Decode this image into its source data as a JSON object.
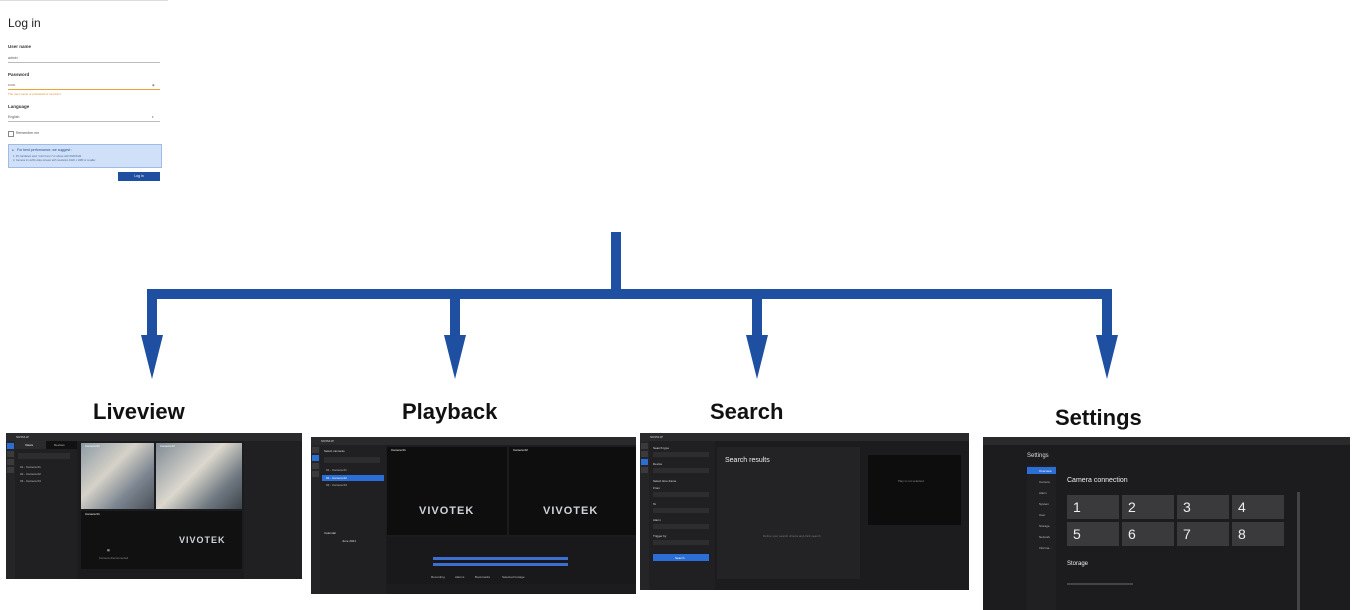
{
  "login": {
    "title": "Log in",
    "username_label": "User name",
    "username_value": "admin",
    "password_label": "Password",
    "password_value": "••••••",
    "password_error": "The user name or password is incorrect",
    "language_label": "Language",
    "language_value": "English",
    "remember_label": "Remember me",
    "info_title": "For best performance, we suggest :",
    "info_line1": "1. PC hardware spec: Intel Core i7 or above with 8GB RAM",
    "info_line2": "2. Camera in H.264 video stream with resolution 1920 x 1080 or smaller",
    "login_button": "Log in"
  },
  "branches": [
    {
      "label": "Liveview"
    },
    {
      "label": "Playback"
    },
    {
      "label": "Search"
    },
    {
      "label": "Settings"
    }
  ],
  "liveview": {
    "brand": "ND9541P",
    "tab_views": "Views",
    "tab_devices": "Devices",
    "cam1": "Camera 01",
    "cam2": "Camera 02",
    "camera_label": "Camera 01",
    "list": [
      "01 - Camera 01",
      "02 - Camera 02",
      "03 - Camera 03"
    ],
    "no_signal": "Camera disconnected",
    "logo": "VIVOTEK"
  },
  "playback": {
    "brand": "ND9541P",
    "select_cameras": "Select cameras",
    "cam_list": [
      "01 - Camera 01",
      "02 - Camera 02",
      "03 - Camera 03"
    ],
    "cam1": "Camera 01",
    "cam2": "Camera 02",
    "calendar": "Calendar",
    "month": "June 2021",
    "logo": "VIVOTEK",
    "legend": [
      "Recording",
      "Alarms",
      "Bookmarks",
      "Selected footage"
    ]
  },
  "search": {
    "brand": "ND9541P",
    "search_type": "Search type",
    "device": "Device",
    "select_time_frame": "Select time frame",
    "from": "From",
    "to": "To",
    "alarm": "Alarm",
    "trigger_by": "Trigger by",
    "search_button": "Search",
    "results_title": "Search results",
    "empty_hint": "Define your search criteria and click search",
    "player_hint": "Play is not selected"
  },
  "settings": {
    "title": "Settings",
    "menu": [
      "Overview",
      "Camera",
      "Alarm",
      "System",
      "User",
      "Storage",
      "Network",
      "Informa..."
    ],
    "camera_connection": "Camera connection",
    "slots": [
      "1",
      "2",
      "3",
      "4",
      "5",
      "6",
      "7",
      "8"
    ],
    "storage": "Storage"
  },
  "colors": {
    "accent": "#1f4fa0",
    "dark_bg": "#1c1c1e"
  }
}
